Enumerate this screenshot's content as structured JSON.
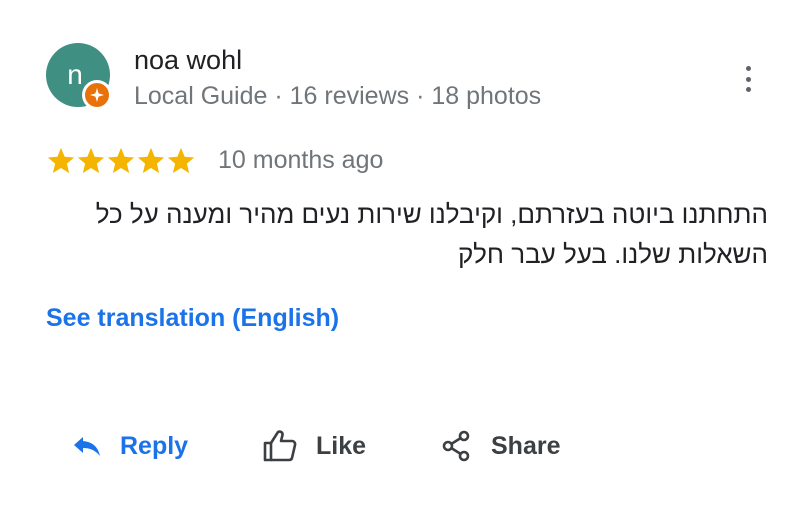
{
  "reviewer": {
    "avatar_letter": "n",
    "avatar_color": "#3f8f83",
    "badge_icon": "local-guide-badge-icon",
    "badge_color": "#e8710a",
    "name": "noa wohl",
    "meta": "Local Guide · 16 reviews · 18 photos"
  },
  "menu": {
    "icon": "more-vertical-icon"
  },
  "review": {
    "rating": 5,
    "rating_max": 5,
    "star_color": "#f4b400",
    "date": "10 months ago",
    "text": "התחתנו ביוטה בעזרתם, וקיבלנו שירות נעים מהיר ומענה על כל השאלות שלנו. בעל עבר חלק",
    "translate_link": "See translation (English)"
  },
  "actions": {
    "reply": {
      "label": "Reply",
      "icon": "reply-arrow-icon"
    },
    "like": {
      "label": "Like",
      "icon": "thumbs-up-icon"
    },
    "share": {
      "label": "Share",
      "icon": "share-icon"
    }
  },
  "colors": {
    "link": "#1a73e8",
    "secondary_text": "#70757a"
  }
}
